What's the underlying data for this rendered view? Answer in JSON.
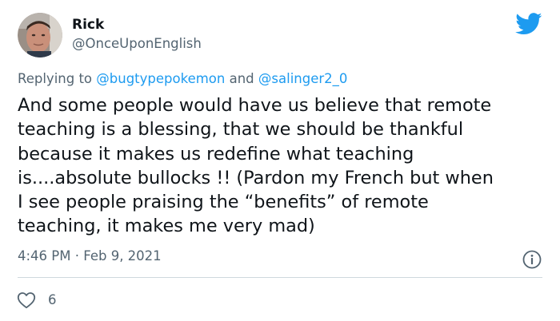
{
  "user": {
    "display_name": "Rick",
    "handle": "@OnceUponEnglish"
  },
  "reply": {
    "prefix": "Replying to",
    "mention_1": "@bugtypepokemon",
    "conjunction": "and",
    "mention_2": "@salinger2_0"
  },
  "tweet": {
    "lines": [
      "And some people would have us believe that remote",
      "teaching is a blessing, that we should be thankful",
      "because it makes us redefine what teaching",
      "is....absolute bullocks !! (Pardon my French but when",
      "I see people praising the “benefits” of remote",
      "teaching, it makes me very mad)"
    ]
  },
  "meta": {
    "time": "4:46 PM",
    "separator": "·",
    "date": "Feb 9, 2021"
  },
  "engagement": {
    "like_count": "6"
  },
  "icons": {
    "brand": "twitter-bird-icon",
    "info": "info-icon",
    "like": "heart-icon"
  },
  "colors": {
    "brand_blue": "#1d9bf0",
    "secondary_text": "#536471",
    "primary_text": "#0f1419"
  }
}
